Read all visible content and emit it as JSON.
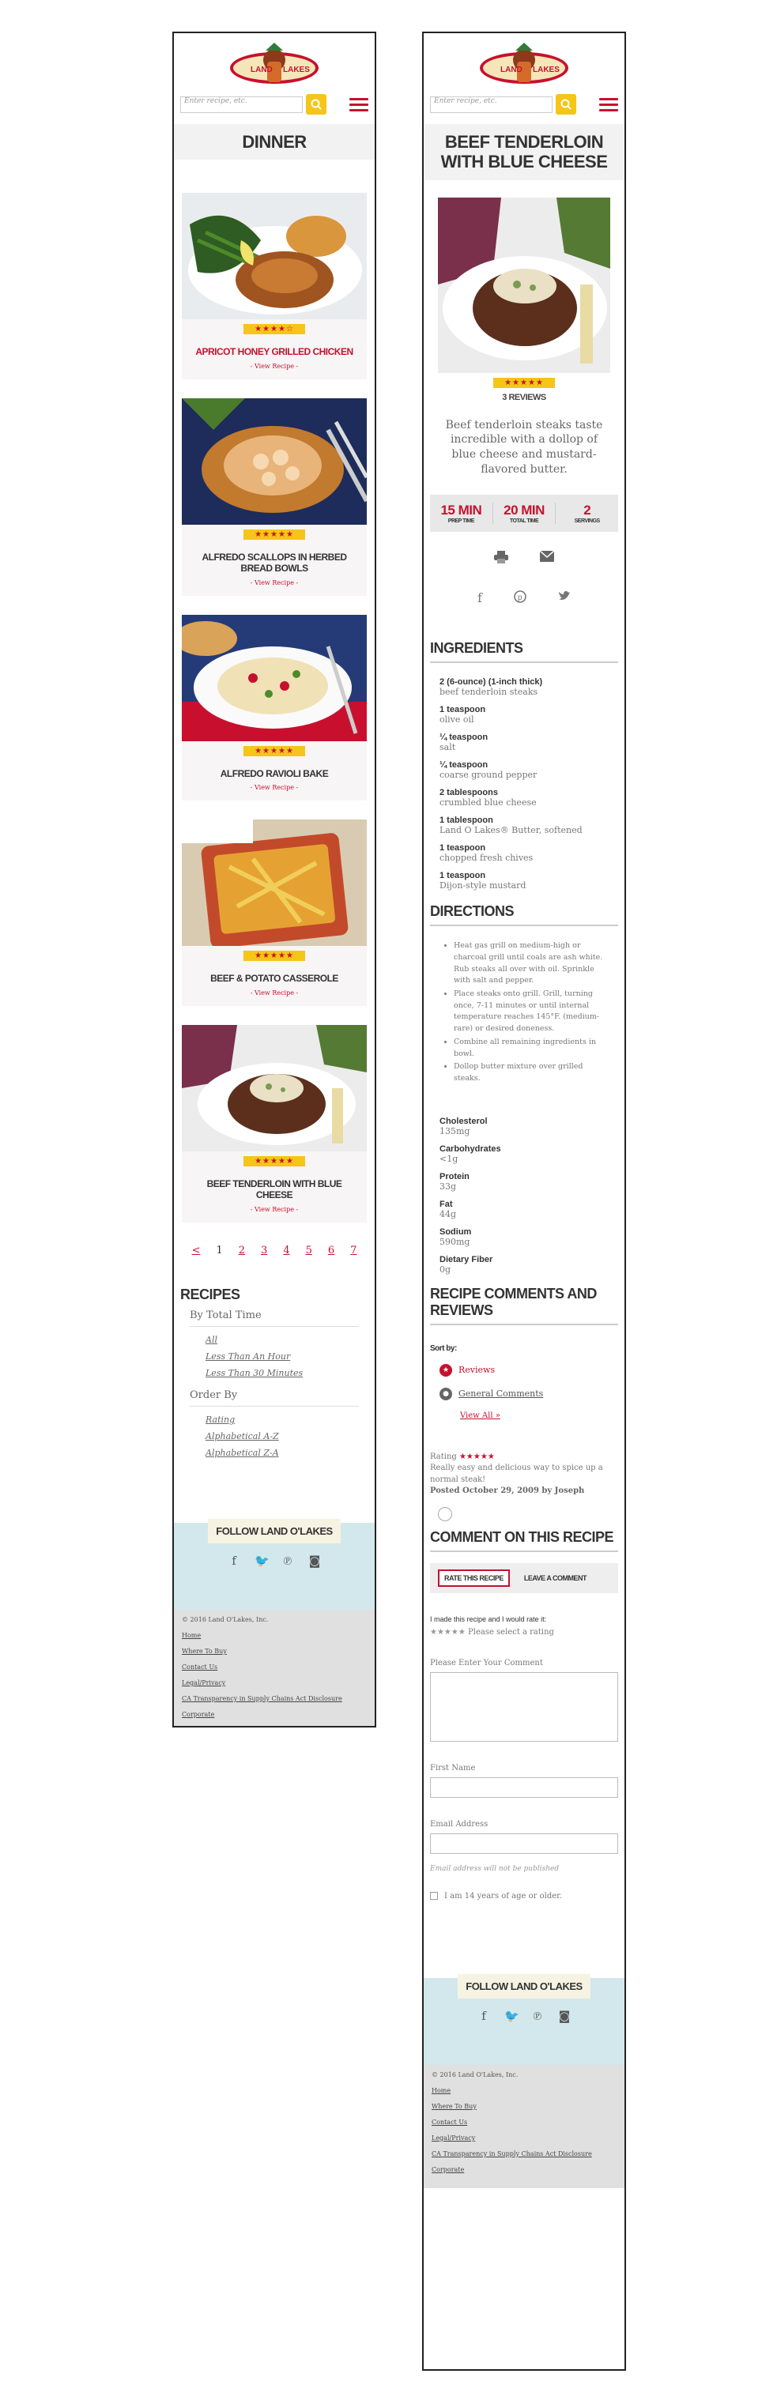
{
  "brand": {
    "logo_text": "LAND O LAKES"
  },
  "search": {
    "placeholder": "Enter recipe, etc."
  },
  "left": {
    "page_title": "DINNER",
    "recipes": [
      {
        "name": "APRICOT HONEY GRILLED CHICKEN",
        "stars": "★★★★☆",
        "view": "View Recipe",
        "highlight": true
      },
      {
        "name": "ALFREDO SCALLOPS IN HERBED BREAD BOWLS",
        "stars": "★★★★★",
        "view": "View Recipe",
        "highlight": false
      },
      {
        "name": "ALFREDO RAVIOLI BAKE",
        "stars": "★★★★★",
        "view": "View Recipe",
        "highlight": false
      },
      {
        "name": "BEEF & POTATO CASSEROLE",
        "stars": "★★★★★",
        "view": "View Recipe",
        "highlight": false
      },
      {
        "name": "BEEF TENDERLOIN WITH BLUE CHEESE",
        "stars": "★★★★★",
        "view": "View Recipe",
        "highlight": false
      }
    ],
    "pagination": {
      "prev": "<",
      "pages": [
        "1",
        "2",
        "3",
        "4",
        "5",
        "6",
        "7"
      ],
      "current": "1"
    },
    "filters": {
      "heading": "RECIPES",
      "groups": [
        {
          "label": "By Total Time",
          "links": [
            "All",
            "Less Than An Hour",
            "Less Than 30 Minutes"
          ]
        },
        {
          "label": "Order By",
          "links": [
            "Rating",
            "Alphabetical A-Z",
            "Alphabetical Z-A"
          ]
        }
      ]
    }
  },
  "follow": {
    "label": "FOLLOW LAND O'LAKES"
  },
  "footer": {
    "copyright": "© 2016 Land O'Lakes, Inc.",
    "links": [
      "Home",
      "Where To Buy",
      "Contact Us",
      "Legal/Privacy",
      "CA Transparency in Supply Chains Act Disclosure",
      "Corporate"
    ]
  },
  "right": {
    "page_title": "BEEF TENDERLOIN WITH BLUE CHEESE",
    "stars": "★★★★★",
    "reviews": "3 REVIEWS",
    "description": "Beef tenderloin steaks taste incredible with a dollop of blue cheese and mustard-flavored butter.",
    "stats": [
      {
        "value": "15 MIN",
        "label": "PREP TIME"
      },
      {
        "value": "20 MIN",
        "label": "TOTAL TIME"
      },
      {
        "value": "2",
        "label": "SERVINGS"
      }
    ],
    "ingredients_title": "INGREDIENTS",
    "ingredients": [
      {
        "qty": "2 (6-ounce) (1-inch thick)",
        "name": "beef tenderloin steaks"
      },
      {
        "qty": "1 teaspoon",
        "name": "olive oil"
      },
      {
        "qty": "¼ teaspoon",
        "name": "salt"
      },
      {
        "qty": "¼ teaspoon",
        "name": "coarse ground pepper"
      },
      {
        "qty": "2 tablespoons",
        "name": "crumbled blue cheese"
      },
      {
        "qty": "1 tablespoon",
        "name": "Land O Lakes® Butter, softened"
      },
      {
        "qty": "1 teaspoon",
        "name": "chopped fresh chives"
      },
      {
        "qty": "1 teaspoon",
        "name": "Dijon-style mustard"
      }
    ],
    "directions_title": "DIRECTIONS",
    "directions": [
      "Heat gas grill on medium-high or charcoal grill until coals are ash white. Rub steaks all over with oil. Sprinkle with salt and pepper.",
      "Place steaks onto grill. Grill, turning once, 7-11 minutes or until internal temperature reaches 145°F. (medium-rare) or desired doneness.",
      "Combine all remaining ingredients in bowl.",
      "Dollop butter mixture over grilled steaks."
    ],
    "nutrition": [
      {
        "name": "Cholesterol",
        "value": "135mg"
      },
      {
        "name": "Carbohydrates",
        "value": "<1g"
      },
      {
        "name": "Protein",
        "value": "33g"
      },
      {
        "name": "Fat",
        "value": "44g"
      },
      {
        "name": "Sodium",
        "value": "590mg"
      },
      {
        "name": "Dietary Fiber",
        "value": "0g"
      }
    ],
    "comments_title": "RECIPE COMMENTS AND REVIEWS",
    "sort_by": "Sort by:",
    "sort_options": [
      "Reviews",
      "General Comments"
    ],
    "view_all": "View All »",
    "review": {
      "rating_label": "Rating",
      "stars": "★★★★★",
      "text": "Really easy and delicious way to spice up a normal steak!",
      "posted": "Posted October 29, 2009 by Joseph"
    },
    "comment_title": "COMMENT ON THIS RECIPE",
    "tabs": [
      "RATE THIS RECIPE",
      "LEAVE A COMMENT"
    ],
    "rate_prompt": "I made this recipe and I would rate it:",
    "rate_stars": "★★★★★",
    "rate_hint": "Please select a rating",
    "form": {
      "comment_label": "Please Enter Your Comment",
      "first_name_label": "First Name",
      "email_label": "Email Address",
      "email_note": "Email address will not be published",
      "age_label": "I am 14 years of age or older."
    }
  }
}
